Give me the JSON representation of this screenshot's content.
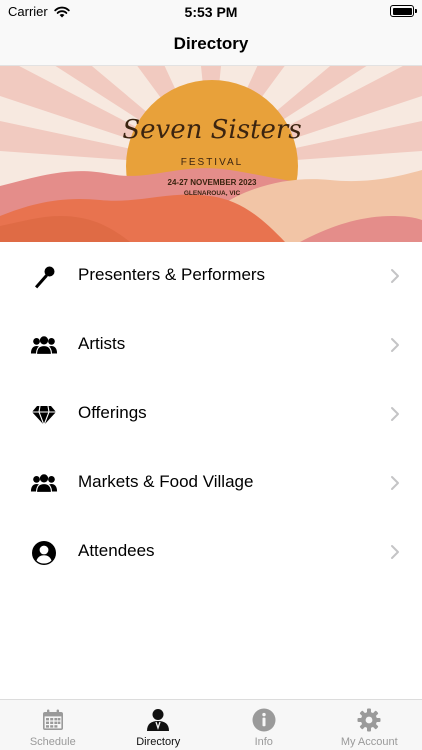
{
  "status_bar": {
    "carrier": "Carrier",
    "time": "5:53 PM"
  },
  "nav": {
    "title": "Directory"
  },
  "banner": {
    "title": "Seven Sisters",
    "subtitle": "FESTIVAL",
    "dates": "24-27 NOVEMBER 2023",
    "location": "GLENAROUA, VIC"
  },
  "menu": [
    {
      "label": "Presenters & Performers",
      "icon": "microphone-icon"
    },
    {
      "label": "Artists",
      "icon": "people-icon"
    },
    {
      "label": "Offerings",
      "icon": "diamond-icon"
    },
    {
      "label": "Markets & Food Village",
      "icon": "people-icon"
    },
    {
      "label": "Attendees",
      "icon": "user-circle-icon"
    }
  ],
  "tabs": [
    {
      "label": "Schedule",
      "icon": "calendar-icon",
      "active": false
    },
    {
      "label": "Directory",
      "icon": "person-icon",
      "active": true
    },
    {
      "label": "Info",
      "icon": "info-icon",
      "active": false
    },
    {
      "label": "My Account",
      "icon": "gear-icon",
      "active": false
    }
  ],
  "colors": {
    "accent": "#111111",
    "inactive_tab": "#9a9a9a",
    "sun": "#e8a13a",
    "banner_bg": "#f7e9e0"
  }
}
